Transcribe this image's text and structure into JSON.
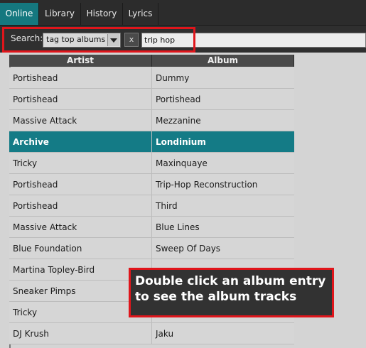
{
  "tabs": [
    {
      "label": "Online",
      "active": true
    },
    {
      "label": "Library",
      "active": false
    },
    {
      "label": "History",
      "active": false
    },
    {
      "label": "Lyrics",
      "active": false
    }
  ],
  "search": {
    "label": "Search:",
    "mode": "tag top albums",
    "clear_label": "x",
    "query": "trip hop"
  },
  "table": {
    "columns": [
      "Artist",
      "Album"
    ],
    "rows": [
      {
        "artist": "Portishead",
        "album": "Dummy"
      },
      {
        "artist": "Portishead",
        "album": "Portishead"
      },
      {
        "artist": "Massive Attack",
        "album": "Mezzanine"
      },
      {
        "artist": "Archive",
        "album": "Londinium",
        "selected": true
      },
      {
        "artist": "Tricky",
        "album": "Maxinquaye"
      },
      {
        "artist": "Portishead",
        "album": "Trip-Hop Reconstruction"
      },
      {
        "artist": "Portishead",
        "album": "Third"
      },
      {
        "artist": "Massive Attack",
        "album": "Blue Lines"
      },
      {
        "artist": "Blue Foundation",
        "album": "Sweep Of Days"
      },
      {
        "artist": "Martina Topley-Bird",
        "album": ""
      },
      {
        "artist": "Sneaker Pimps",
        "album": ""
      },
      {
        "artist": "Tricky",
        "album": ""
      },
      {
        "artist": "DJ Krush",
        "album": "Jaku"
      }
    ]
  },
  "tooltip": {
    "text": "Double click an album entry\nto see the album tracks"
  },
  "colors": {
    "accent": "#15787f",
    "highlight_border": "#e0151b"
  }
}
